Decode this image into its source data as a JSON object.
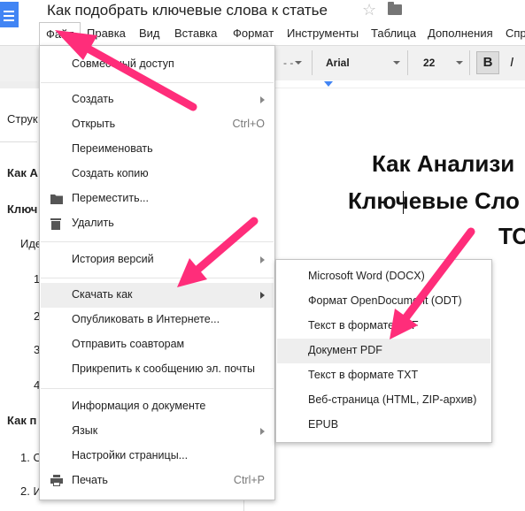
{
  "title": "Как подобрать ключевые слова к статье",
  "menubar": [
    "Файл",
    "Правка",
    "Вид",
    "Вставка",
    "Формат",
    "Инструменты",
    "Таблица",
    "Дополнения",
    "Спр"
  ],
  "toolbar": {
    "font": "Arial",
    "size": "22",
    "bold": "B",
    "italic": "I"
  },
  "outline": {
    "label": "Струк",
    "items": [
      "Как А",
      "Ключ",
      "Иде",
      "1",
      "2",
      "3",
      "4",
      "Как п",
      "1. О",
      "2. И"
    ]
  },
  "document": {
    "line1": "Как Анализи",
    "line2": "Ключевые Сло",
    "line3": "ТО"
  },
  "file_menu": {
    "share": "Совместный доступ",
    "new": "Создать",
    "open": "Открыть",
    "open_shortcut": "Ctrl+O",
    "rename": "Переименовать",
    "make_copy": "Создать копию",
    "move": "Переместить...",
    "delete": "Удалить",
    "version_history": "История версий",
    "download_as": "Скачать как",
    "publish": "Опубликовать в Интернете...",
    "email_collaborators": "Отправить соавторам",
    "email_attachment": "Прикрепить к сообщению эл. почты",
    "doc_details": "Информация о документе",
    "language": "Язык",
    "page_setup": "Настройки страницы...",
    "print": "Печать",
    "print_shortcut": "Ctrl+P"
  },
  "download_submenu": [
    "Microsoft Word (DOCX)",
    "Формат OpenDocument (ODT)",
    "Текст в формате RTF",
    "Документ PDF",
    "Текст в формате TXT",
    "Веб-страница (HTML, ZIP-архив)",
    "EPUB"
  ],
  "colors": {
    "accent": "#4285f4",
    "arrow": "#ff2d7a",
    "highlight": "#eeeeee"
  }
}
